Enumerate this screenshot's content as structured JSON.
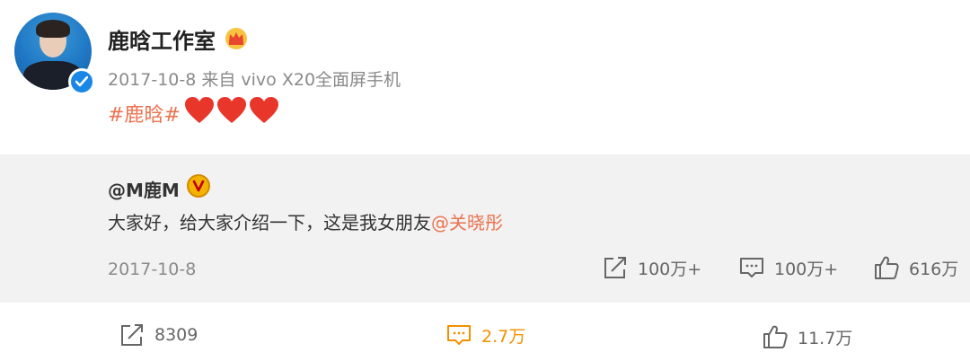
{
  "post": {
    "author": "鹿晗工作室",
    "meta": "2017-10-8  来自 vivo X20全面屏手机",
    "hashtag": "#鹿晗#",
    "emoji_count": 3
  },
  "repost": {
    "author": "@M鹿M",
    "text": "大家好，给大家介绍一下，这是我女朋友",
    "mention": "@关晓彤",
    "date": "2017-10-8",
    "shares": "100万+",
    "comments": "100万+",
    "likes": "616万"
  },
  "footer": {
    "shares": "8309",
    "comments": "2.7万",
    "likes": "11.7万"
  },
  "colors": {
    "accent": "#eb7350",
    "comment_active": "#f29100",
    "verified_blue": "#1a87e6",
    "repost_bg": "#f2f2f2"
  },
  "icons": {
    "verified": "verified-badge-icon",
    "crown": "crown-icon",
    "heart": "heart-icon",
    "v_badge": "v-badge-icon",
    "share": "share-icon",
    "comment": "comment-icon",
    "like": "thumbs-up-icon"
  }
}
